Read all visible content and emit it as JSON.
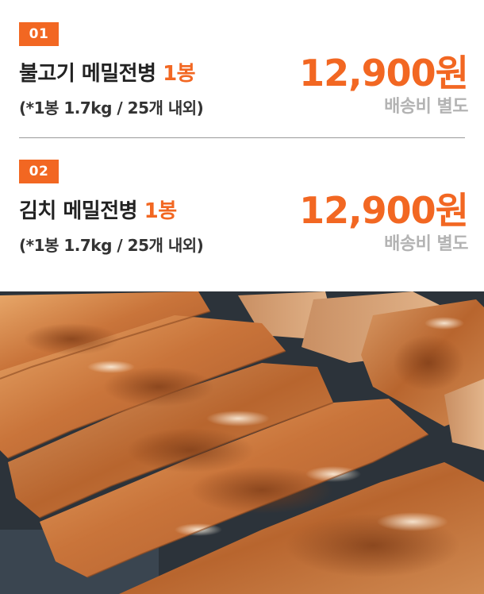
{
  "products": [
    {
      "badge": "01",
      "name": "불고기 메밀전병",
      "quantity": "1봉",
      "description": "(*1봉 1.7kg / 25개 내외)",
      "price": "12,900원",
      "shipping": "배송비 별도"
    },
    {
      "badge": "02",
      "name": "김치 메밀전병",
      "quantity": "1봉",
      "description": "(*1봉 1.7kg / 25개 내외)",
      "price": "12,900원",
      "shipping": "배송비 별도"
    }
  ],
  "colors": {
    "accent": "#f26722",
    "muted": "#b3b3b3",
    "text": "#222222"
  },
  "photo": {
    "subject": "pan-fried buckwheat crepe rolls on a dark griddle"
  }
}
